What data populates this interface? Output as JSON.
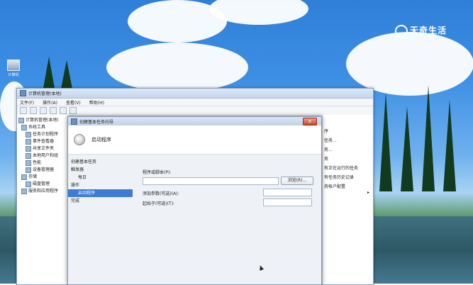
{
  "watermark": {
    "text": "天奇生活"
  },
  "desktop_icon": {
    "label": "计算机"
  },
  "main_window": {
    "title": "计算机管理(本地)",
    "menu": [
      "文件(F)",
      "操作(A)",
      "查看(V)",
      "帮助(H)"
    ],
    "tree": [
      {
        "label": "计算机管理(本地)",
        "level": 0
      },
      {
        "label": "系统工具",
        "level": 1
      },
      {
        "label": "任务计划程序",
        "level": 2
      },
      {
        "label": "事件查看器",
        "level": 2
      },
      {
        "label": "共享文件夹",
        "level": 2
      },
      {
        "label": "本地用户和组",
        "level": 2
      },
      {
        "label": "性能",
        "level": 2
      },
      {
        "label": "设备管理器",
        "level": 2
      },
      {
        "label": "存储",
        "level": 1
      },
      {
        "label": "磁盘管理",
        "level": 2
      },
      {
        "label": "服务和应用程序",
        "level": 1
      }
    ],
    "actions": [
      "序",
      "任务...",
      "务...",
      "务",
      "有正在运行的任务",
      "有任务历史记录",
      "务帐户配置"
    ]
  },
  "dialog": {
    "title": "创建基本任务向导",
    "header": "启动程序",
    "close_label": "x",
    "steps": [
      {
        "label": "创建基本任务",
        "indent": false,
        "selected": false
      },
      {
        "label": "触发器",
        "indent": false,
        "selected": false
      },
      {
        "label": "每日",
        "indent": true,
        "selected": false
      },
      {
        "label": "操作",
        "indent": false,
        "selected": false
      },
      {
        "label": "启动程序",
        "indent": true,
        "selected": true
      },
      {
        "label": "完成",
        "indent": false,
        "selected": false
      }
    ],
    "form": {
      "program_label": "程序或脚本(P):",
      "program_value": "",
      "browse_label": "浏览(R)...",
      "args_label": "添加参数(可选)(A):",
      "args_value": "",
      "start_in_label": "起始于(可选)(T):",
      "start_in_value": ""
    }
  },
  "colors": {
    "selection": "#3d7bd6",
    "close": "#c8472a"
  }
}
